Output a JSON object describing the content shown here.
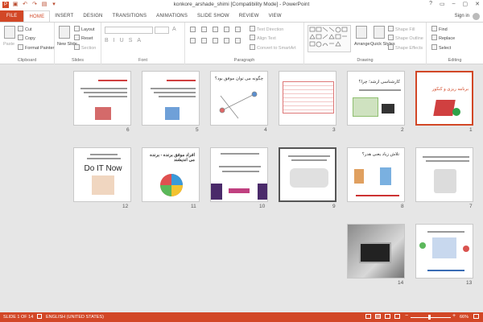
{
  "window": {
    "title": "konkore_arshade_shimi [Compatibility Mode] - PowerPoint",
    "controls": [
      "?",
      "▭",
      "–",
      "▢",
      "✕"
    ]
  },
  "tabs": [
    "FILE",
    "HOME",
    "INSERT",
    "DESIGN",
    "TRANSITIONS",
    "ANIMATIONS",
    "SLIDE SHOW",
    "REVIEW",
    "VIEW"
  ],
  "active_tab": "HOME",
  "signin": "Sign in",
  "ribbon": {
    "clipboard": {
      "label": "Clipboard",
      "paste": "Paste",
      "cut": "Cut",
      "copy": "Copy",
      "format_painter": "Format Painter"
    },
    "slides": {
      "label": "Slides",
      "new_slide": "New Slide",
      "layout": "Layout",
      "reset": "Reset",
      "section": "Section"
    },
    "font": {
      "label": "Font"
    },
    "paragraph": {
      "label": "Paragraph",
      "text_direction": "Text Direction",
      "align_text": "Align Text",
      "convert": "Convert to SmartArt"
    },
    "drawing": {
      "label": "Drawing",
      "arrange": "Arrange",
      "quick_styles": "Quick Styles",
      "shape_fill": "Shape Fill",
      "shape_outline": "Shape Outline",
      "shape_effects": "Shape Effects"
    },
    "editing": {
      "label": "Editing",
      "find": "Find",
      "replace": "Replace",
      "select": "Select"
    }
  },
  "slides": [
    {
      "n": "1",
      "text": "برنامه ریزی و کنکور"
    },
    {
      "n": "2",
      "text": "کارشناسی ارشد؛ چرا؟"
    },
    {
      "n": "3",
      "text": ""
    },
    {
      "n": "4",
      "text": "چگونه می توان موفق بود؟"
    },
    {
      "n": "5",
      "text": ""
    },
    {
      "n": "6",
      "text": ""
    },
    {
      "n": "7",
      "text": ""
    },
    {
      "n": "8",
      "text": "تلاش زیاد یعنی هدر؟"
    },
    {
      "n": "9",
      "text": ""
    },
    {
      "n": "10",
      "text": ""
    },
    {
      "n": "11",
      "text": "افراد موفق برنده - برنده می اندیشند"
    },
    {
      "n": "12",
      "text": "Do IT Now"
    },
    {
      "n": "13",
      "text": ""
    },
    {
      "n": "14",
      "text": ""
    }
  ],
  "status": {
    "slide_info": "SLIDE 1 OF 14",
    "language": "ENGLISH (UNITED STATES)",
    "zoom": "66%"
  },
  "colors": {
    "accent": "#d24726",
    "background": "#e6e6e6"
  }
}
